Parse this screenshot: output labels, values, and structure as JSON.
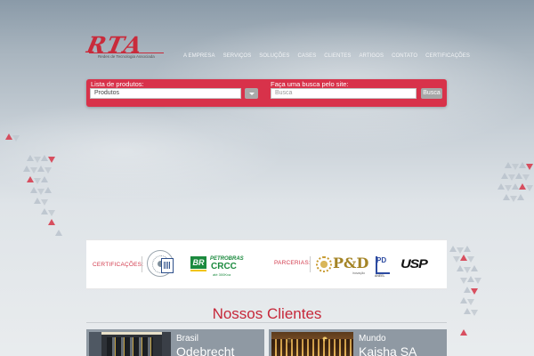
{
  "logo": {
    "text": "RTA",
    "tagline": "Redes de Tecnologia Associada"
  },
  "nav": {
    "items": [
      "A EMPRESA",
      "SERVIÇOS",
      "SOLUÇÕES",
      "CASES",
      "CLIENTES",
      "ARTIGOS",
      "CONTATO",
      "CERTIFICAÇÕES"
    ]
  },
  "search": {
    "products_label": "Lista de produtos:",
    "products_selected": "Produtos",
    "site_label": "Faça uma busca pelo site:",
    "site_placeholder": "Busca",
    "button_label": "Busca"
  },
  "certifications": {
    "label": "CERTIFICAÇÕES:",
    "partners_label": "PARCERIAS:",
    "petrobras_brand": "BR",
    "petrobras_name": "PETROBRAS",
    "crcc": "CRCC",
    "crcc_sub": "até 300Kva",
    "pd": "P&D",
    "pd_sub": "inovação",
    "aneel_mark": "PD",
    "aneel": "ANEEL",
    "usp": "USP"
  },
  "clients": {
    "title": "Nossos Clientes",
    "cards": [
      {
        "region": "Brasil",
        "name": "Odebrecht"
      },
      {
        "region": "Mundo",
        "name": "Kaisha SA"
      }
    ]
  },
  "colors": {
    "accent": "#d8324a",
    "brand_red": "#c92b3b",
    "petrobras_green": "#1b8a3e"
  }
}
